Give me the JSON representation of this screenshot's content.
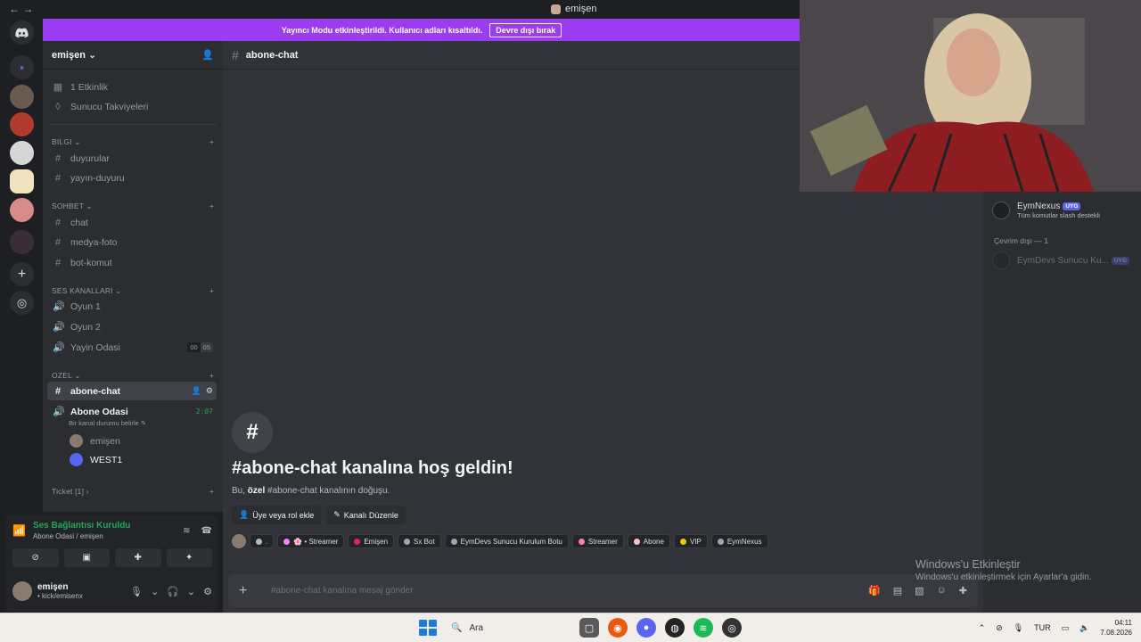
{
  "window": {
    "nav_arrows": "← →",
    "title": "emişen"
  },
  "banner": {
    "text": "Yayıncı Modu etkinleştirildi. Kullanıcı adları kısaltıldı.",
    "button": "Devre dışı bırak"
  },
  "server": {
    "name": "emişen ⌄",
    "invite_icon": "add-person-icon"
  },
  "top_items": [
    {
      "icon": "calendar-icon",
      "label": "1 Etkinlik"
    },
    {
      "icon": "boost-icon",
      "label": "Sunucu Takviyeleri"
    }
  ],
  "categories": {
    "bilgi": "BILGI ⌄",
    "sohbet": "SOHBET ⌄",
    "ses": "SES KANALLARI ⌄",
    "ozel": "OZEL ⌄",
    "ticket": "Ticket [1] ›",
    "add": "+"
  },
  "channels": {
    "duyurular": "duyurular",
    "yayin_duyuru": "yayın-duyuru",
    "chat": "chat",
    "medya_foto": "medya-foto",
    "bot_komut": "bot-komut",
    "oyun1": "Oyun 1",
    "oyun2": "Oyun 2",
    "yayin_odasi": "Yayin Odasi",
    "yayin_count_a": "00",
    "yayin_count_b": "05",
    "abone_chat": "abone-chat",
    "abone_odasi": "Abone Odasi",
    "abone_timer": "2:07",
    "abone_status": "Bir kanal durumu belirle ✎",
    "voice_user1": "emişen",
    "voice_user2": "WEST1"
  },
  "voice_panel": {
    "status": "Ses Bağlantısı Kuruldu",
    "location": "Abone Odasi / emişen",
    "user_name": "emişen",
    "user_sub": "• kick/emisenx"
  },
  "channel_header": {
    "hash": "#",
    "name": "abone-chat"
  },
  "welcome": {
    "icon": "#",
    "title": "#abone-chat kanalına hoş geldin!",
    "sub_pre": "Bu, ",
    "sub_bold": "özel",
    "sub_post": " #abone-chat kanalının doğuşu.",
    "btn_add": "Üye veya rol ekle",
    "btn_edit": "Kanalı Düzenle"
  },
  "roles": [
    {
      "label": ".",
      "color": "#b5bac1"
    },
    {
      "label": "🌸 • Streamer",
      "color": "#f47fff"
    },
    {
      "label": "Emişen",
      "color": "#e91e63"
    },
    {
      "label": "Sx Bot",
      "color": "#99aab5"
    },
    {
      "label": "EymDevs Sunucu Kurulum Botu",
      "color": "#99aab5"
    },
    {
      "label": "Streamer",
      "color": "#ff7eb6"
    },
    {
      "label": "Abone",
      "color": "#ffc0cb"
    },
    {
      "label": "VIP",
      "color": "#f1c40f"
    },
    {
      "label": "EymNexus",
      "color": "#99aab5"
    }
  ],
  "composer": {
    "placeholder": "#abone-chat kanalına mesaj gönder",
    "plus": "+"
  },
  "members": {
    "online_name": "EymNexus",
    "online_tag": "UYG",
    "online_status": "Tüm komutlar slash destekli",
    "offline_header": "Çevrim dışı — 1",
    "offline_name": "EymDevs Sunucu Ku...",
    "offline_tag": "UYG"
  },
  "activation": {
    "line1": "Windows'u Etkinleştir",
    "line2": "Windows'u etkinleştirmek için Ayarlar'a gidin."
  },
  "taskbar": {
    "search": "Ara",
    "lang": "TUR",
    "time": "04:11",
    "date": "7.08.2026"
  },
  "colors": {
    "accent": "#9b3cf0",
    "voice_green": "#23a55a",
    "blurple": "#5865f2"
  }
}
